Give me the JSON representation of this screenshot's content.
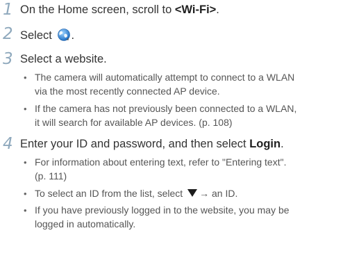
{
  "steps": [
    {
      "num": "1",
      "pre": "On the Home screen, scroll to ",
      "bold": "<Wi-Fi>",
      "post": "."
    },
    {
      "num": "2",
      "pre": "Select ",
      "icon": "globe-icon",
      "post": "."
    },
    {
      "num": "3",
      "text": "Select a website."
    },
    {
      "num": "4",
      "pre": "Enter your ID and password, and then select ",
      "bold": "Login",
      "post": "."
    }
  ],
  "step3_bullets": [
    {
      "line1": "The camera will automatically attempt to connect to a WLAN",
      "line2": "via the most recently connected AP device."
    },
    {
      "line1": "If the camera has not previously been connected to a WLAN,",
      "line2": "it will search for available AP devices. (p. 108)"
    }
  ],
  "step4_bullets": [
    {
      "line1": "For information about entering text, refer to \"Entering text\".",
      "line2": "(p. 111)"
    },
    {
      "pre": "To select an ID from the list, select ",
      "icon": "down-triangle-icon",
      "post": "→ an ID."
    },
    {
      "line1": "If you have previously logged in to the website, you may be",
      "line2": "logged in automatically."
    }
  ],
  "bullet_char": "•",
  "colors": {
    "step_number": "#8fa9bd",
    "text": "#333333"
  }
}
